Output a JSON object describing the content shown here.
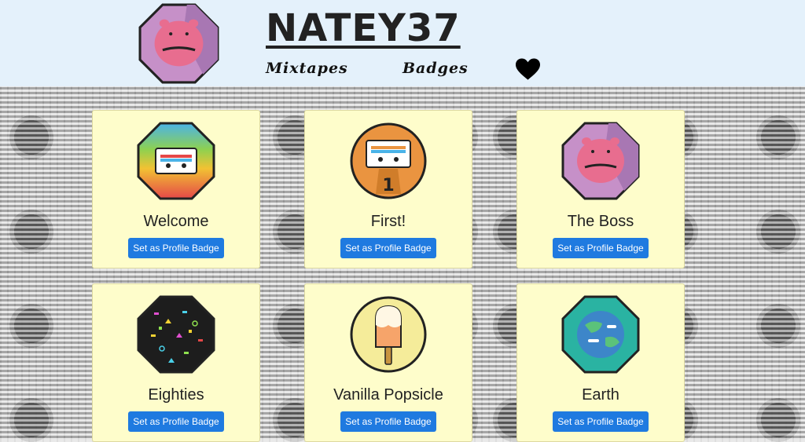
{
  "header": {
    "username": "NATEY37",
    "nav": {
      "mixtapes": "Mixtapes",
      "badges": "Badges"
    },
    "icons": {
      "avatar": "hippo-avatar-icon",
      "heart": "heart-icon"
    }
  },
  "badges": [
    {
      "name": "Welcome",
      "button": "Set as Profile Badge",
      "icon": "rainbow-cassette-icon"
    },
    {
      "name": "First!",
      "button": "Set as Profile Badge",
      "icon": "cassette-number-one-icon"
    },
    {
      "name": "The Boss",
      "button": "Set as Profile Badge",
      "icon": "hippo-icon"
    },
    {
      "name": "Eighties",
      "button": "Set as Profile Badge",
      "icon": "eighties-pattern-icon"
    },
    {
      "name": "Vanilla Popsicle",
      "button": "Set as Profile Badge",
      "icon": "popsicle-icon"
    },
    {
      "name": "Earth",
      "button": "Set as Profile Badge",
      "icon": "earth-icon"
    }
  ],
  "colors": {
    "header_bg": "#e4f1fb",
    "card_bg": "#fefdcb",
    "button": "#1f7ae0"
  }
}
